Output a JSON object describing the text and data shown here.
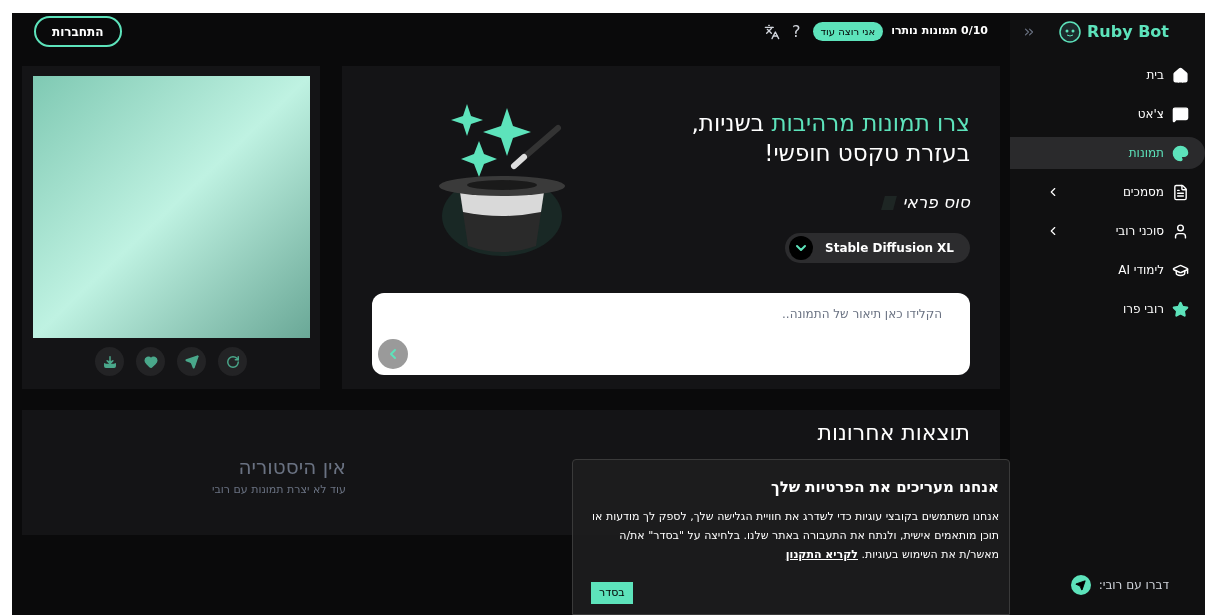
{
  "sidebar": {
    "brand": "Ruby Bot",
    "items": [
      {
        "label": "בית",
        "kind": "home",
        "selected": false,
        "expandable": false
      },
      {
        "label": "צ'אט",
        "kind": "chat",
        "selected": false,
        "expandable": false
      },
      {
        "label": "תמונות",
        "kind": "palette",
        "selected": true,
        "expandable": false
      },
      {
        "label": "מסמכים",
        "kind": "document",
        "selected": false,
        "expandable": true
      },
      {
        "label": "סוכני רובי",
        "kind": "agent",
        "selected": false,
        "expandable": true
      },
      {
        "label": "לימודי AI",
        "kind": "cap",
        "selected": false,
        "expandable": false
      },
      {
        "label": "רובי פרו",
        "kind": "star",
        "selected": false,
        "expandable": false
      }
    ],
    "footer": "דברו עם רובי:"
  },
  "header": {
    "usage": "0/10 תמונות נותרו",
    "upgrade": "אני רוצה עוד",
    "help": "?",
    "login": "התחברות"
  },
  "hero": {
    "title_highlight": "צרו תמונות מרהיבות",
    "title_rest": "בשניות,",
    "title_line2": "בעזרת טקסט חופשי!",
    "style": "סוס פראי",
    "model": "Stable Diffusion XL",
    "prompt_placeholder": "הקלידו כאן תיאור של התמונה.."
  },
  "recent": {
    "title": "תוצאות אחרונות",
    "empty_title": "אין היסטוריה",
    "empty_text": "עוד לא יצרת תמונות עם רובי"
  },
  "cookie": {
    "title": "אנחנו מעריכים את הפרטיות שלך",
    "text": "אנחנו משתמשים בקובצי עוגיות כדי לשדרג את חוויית הגלישה שלך, לספק לך מודעות או תוכן מותאמים אישית, ולנתח את התעבורה באתר שלנו. בלחיצה על \"בסדר\" את/ה מאשר/ת את השימוש בעוגיות.",
    "link": "לקריא התקנון",
    "button": "בסדר"
  }
}
